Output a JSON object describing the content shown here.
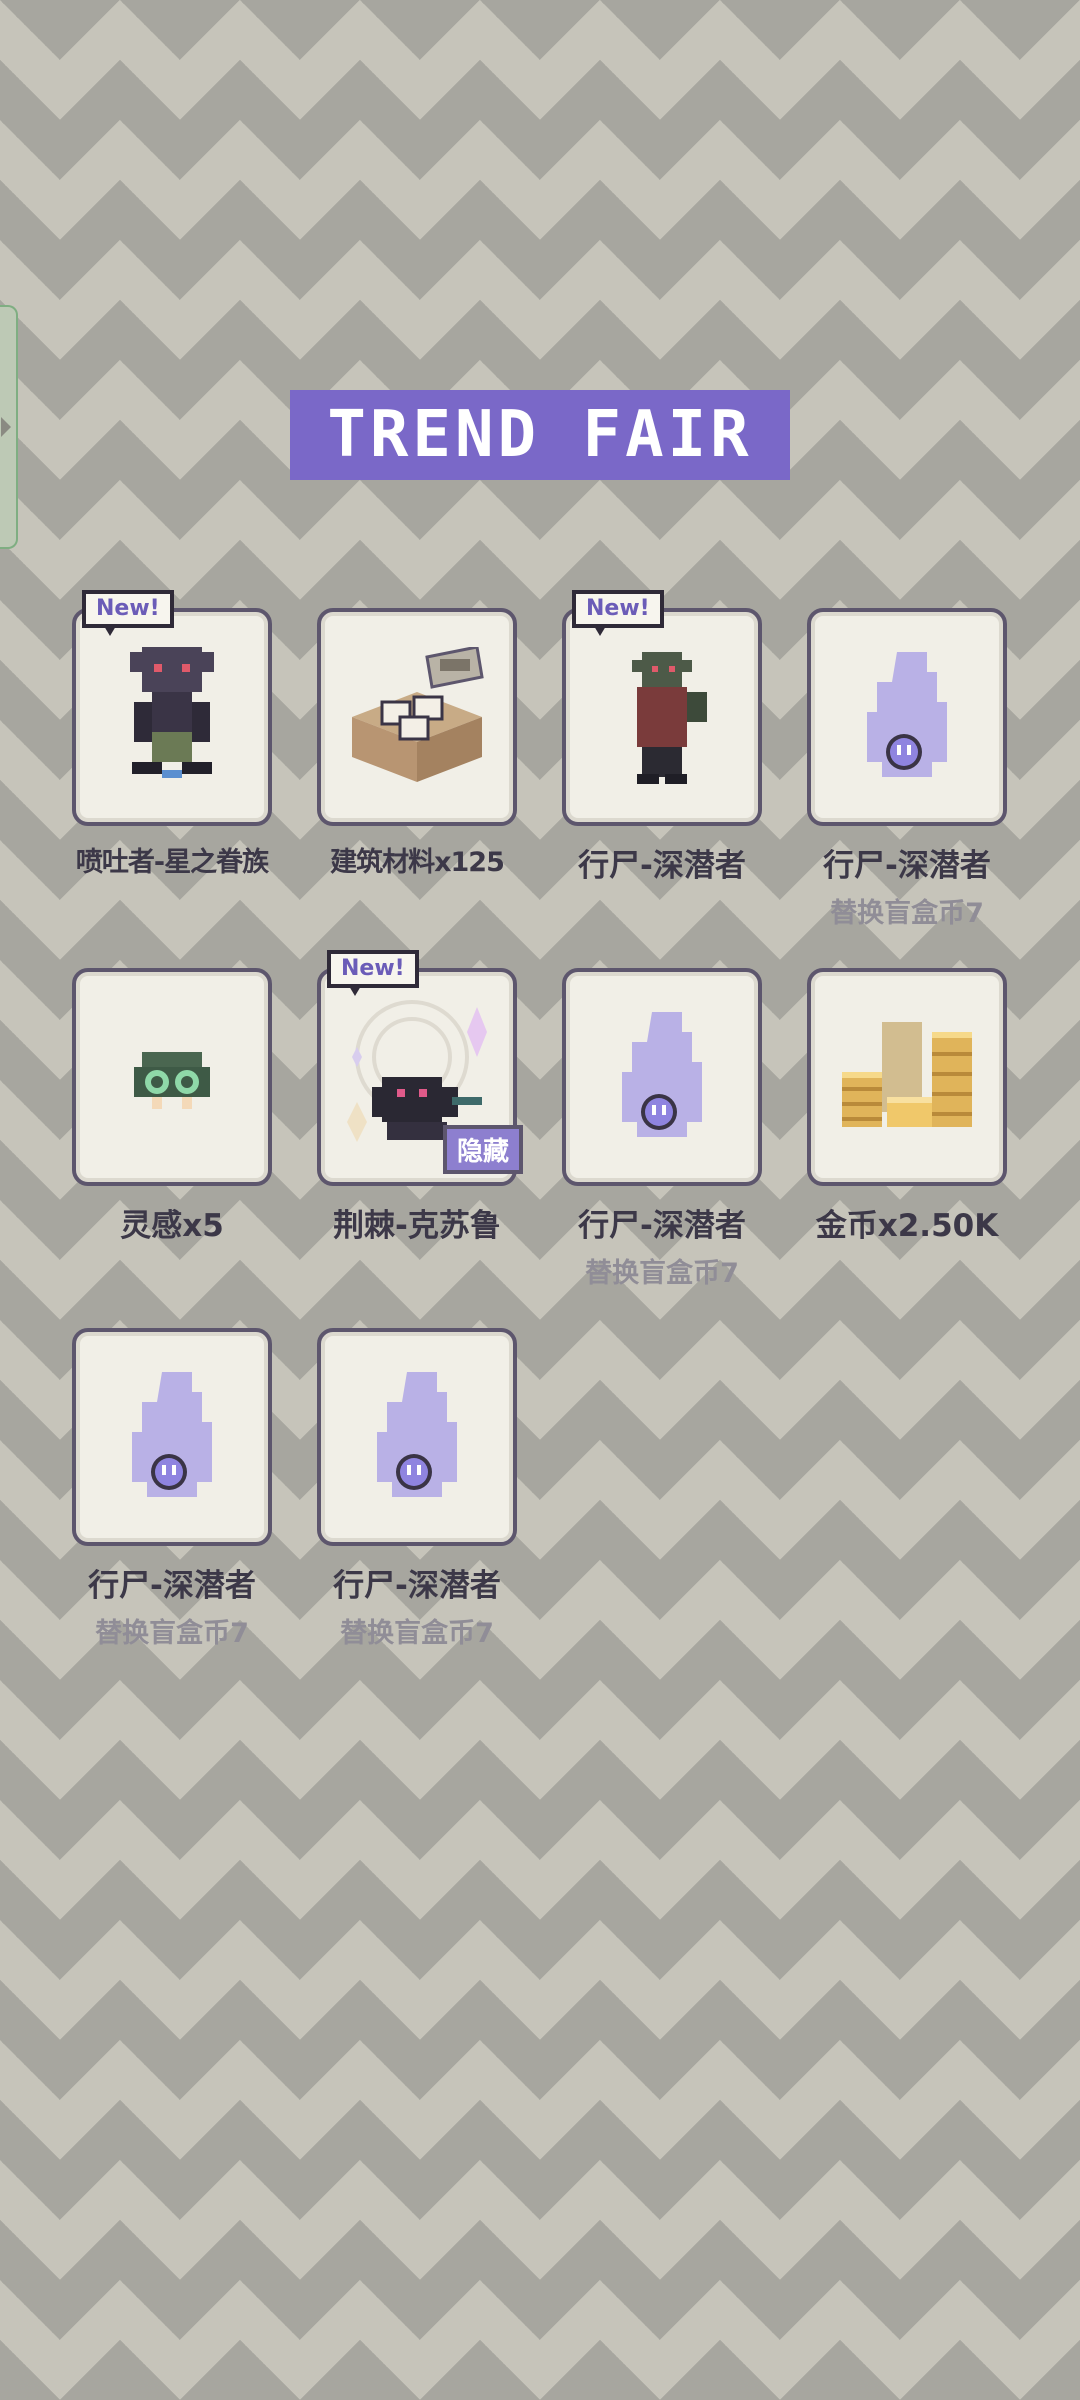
{
  "header": {
    "title": "TREND FAIR"
  },
  "items": [
    {
      "name": "喷吐者-星之眷族",
      "new_label": "New!",
      "icon": "monster-icon"
    },
    {
      "name": "建筑材料x125",
      "icon": "material-box-icon"
    },
    {
      "name": "行尸-深潜者",
      "new_label": "New!",
      "icon": "zombie-deep-one-icon"
    },
    {
      "name": "行尸-深潜者",
      "sub": "替换盲盒币7",
      "icon": "ghost-placeholder-icon"
    },
    {
      "name": "灵感x5",
      "icon": "inspiration-icon"
    },
    {
      "name": "荆棘-克苏鲁",
      "new_label": "New!",
      "hidden_label": "隐藏",
      "icon": "cthulhu-icon"
    },
    {
      "name": "行尸-深潜者",
      "sub": "替换盲盒币7",
      "icon": "ghost-placeholder-icon"
    },
    {
      "name": "金币x2.50K",
      "icon": "gold-coins-icon"
    },
    {
      "name": "行尸-深潜者",
      "sub": "替换盲盒币7",
      "icon": "ghost-placeholder-icon"
    },
    {
      "name": "行尸-深潜者",
      "sub": "替换盲盒币7",
      "icon": "ghost-placeholder-icon"
    }
  ],
  "colors": {
    "accent": "#7a68c8",
    "card_border": "#5d566d",
    "card_bg": "#f1efe7",
    "ghost": "#b9b1e6"
  }
}
